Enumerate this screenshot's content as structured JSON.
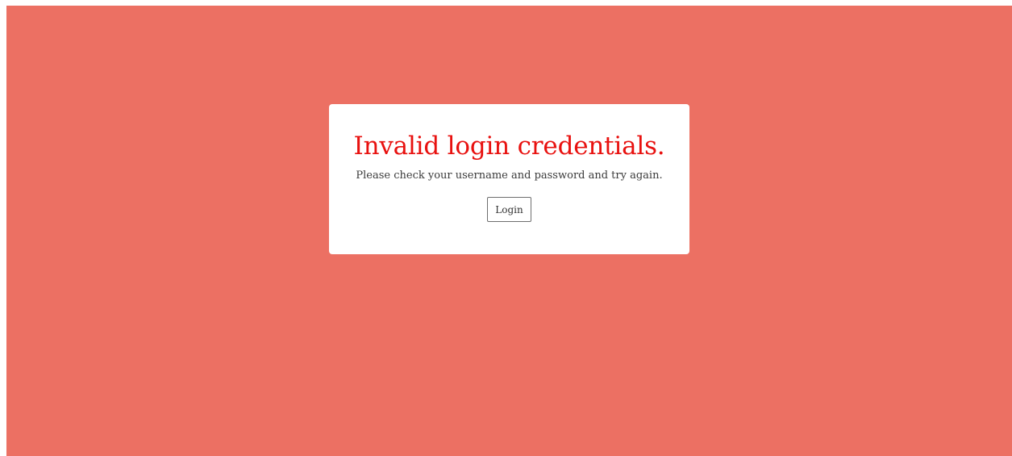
{
  "colors": {
    "background": "#ec7063",
    "card": "#ffffff",
    "title": "#e8110f",
    "text": "#3a3a3a"
  },
  "error": {
    "title": "Invalid login credentials.",
    "message": "Please check your username and password and try again.",
    "login_label": "Login"
  }
}
